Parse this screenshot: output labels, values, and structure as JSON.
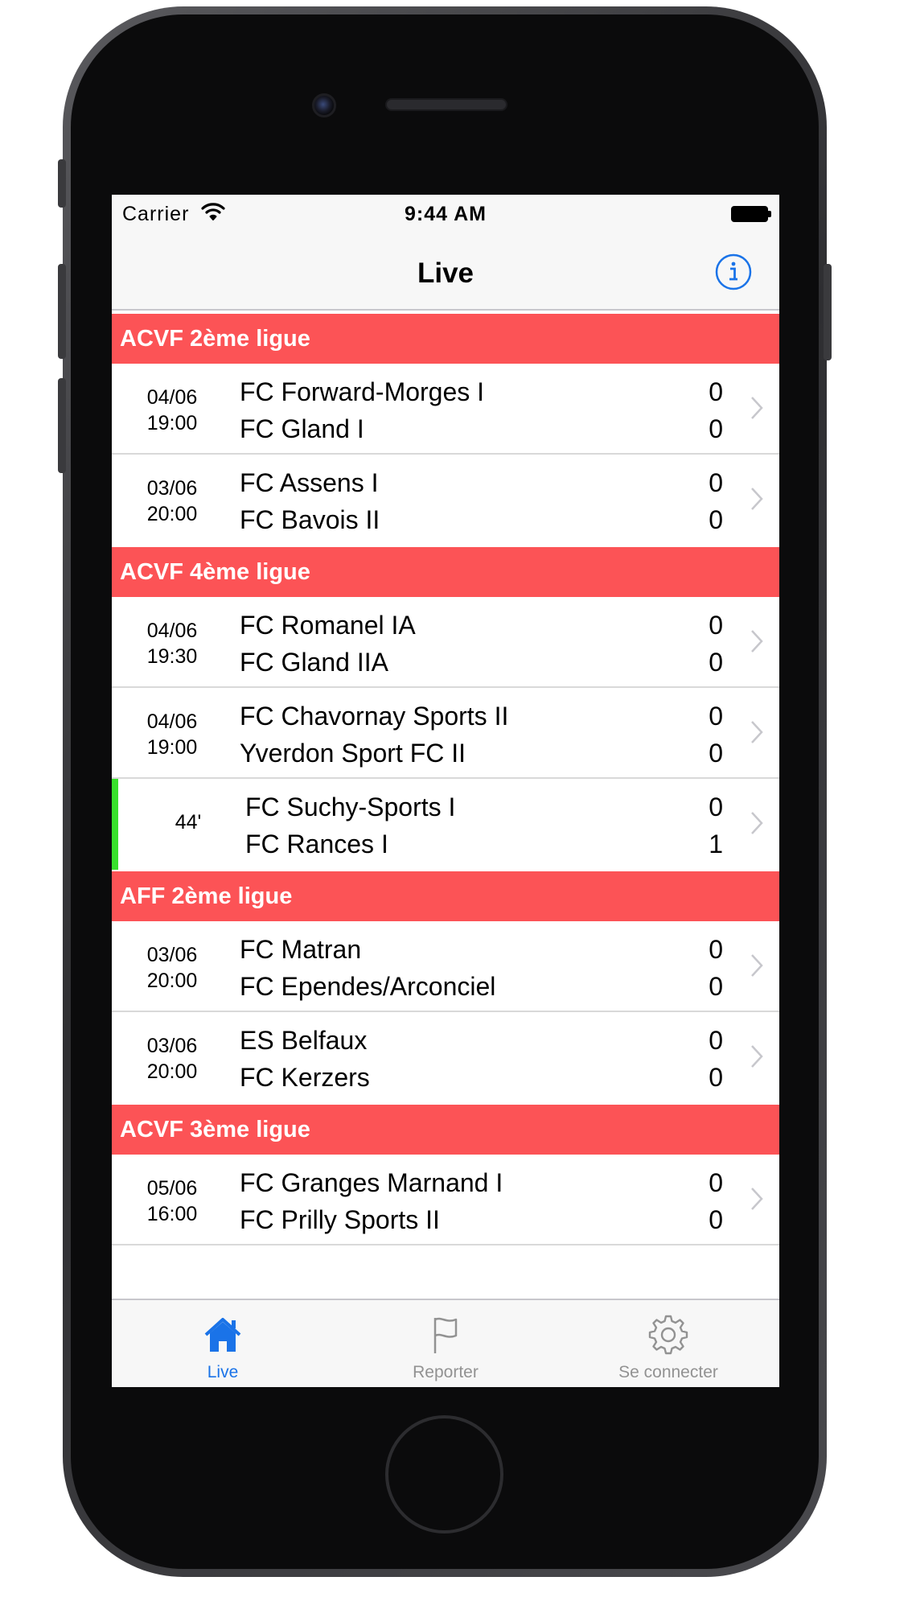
{
  "status_bar": {
    "carrier": "Carrier",
    "time": "9:44 AM"
  },
  "nav": {
    "title": "Live",
    "info_icon": "info-circle-icon"
  },
  "colors": {
    "section_header": "#fc5356",
    "live_indicator": "#39e02c",
    "accent": "#1a73e8"
  },
  "sections": [
    {
      "title": "ACVF 2ème ligue",
      "matches": [
        {
          "date": "04/06",
          "time": "19:00",
          "home": "FC Forward-Morges I",
          "away": "FC Gland I",
          "home_score": "0",
          "away_score": "0"
        },
        {
          "date": "03/06",
          "time": "20:00",
          "home": "FC Assens I",
          "away": "FC Bavois II",
          "home_score": "0",
          "away_score": "0"
        }
      ]
    },
    {
      "title": "ACVF 4ème ligue",
      "matches": [
        {
          "date": "04/06",
          "time": "19:30",
          "home": "FC Romanel IA",
          "away": "FC Gland IIA",
          "home_score": "0",
          "away_score": "0"
        },
        {
          "date": "04/06",
          "time": "19:00",
          "home": "FC Chavornay Sports II",
          "away": "Yverdon Sport FC II",
          "home_score": "0",
          "away_score": "0"
        },
        {
          "minute": "44'",
          "home": "FC Suchy-Sports I",
          "away": "FC Rances I",
          "home_score": "0",
          "away_score": "1",
          "live": true
        }
      ]
    },
    {
      "title": "AFF 2ème ligue",
      "matches": [
        {
          "date": "03/06",
          "time": "20:00",
          "home": "FC Matran",
          "away": "FC Ependes/Arconciel",
          "home_score": "0",
          "away_score": "0"
        },
        {
          "date": "03/06",
          "time": "20:00",
          "home": "ES Belfaux",
          "away": "FC Kerzers",
          "home_score": "0",
          "away_score": "0"
        }
      ]
    },
    {
      "title": "ACVF 3ème ligue",
      "matches": [
        {
          "date": "05/06",
          "time": "16:00",
          "home": "FC Granges Marnand I",
          "away": "FC Prilly Sports II",
          "home_score": "0",
          "away_score": "0"
        }
      ]
    }
  ],
  "tab_bar": {
    "tabs": [
      {
        "label": "Live",
        "icon": "home-icon",
        "active": true
      },
      {
        "label": "Reporter",
        "icon": "flag-icon",
        "active": false
      },
      {
        "label": "Se connecter",
        "icon": "gear-icon",
        "active": false
      }
    ]
  }
}
